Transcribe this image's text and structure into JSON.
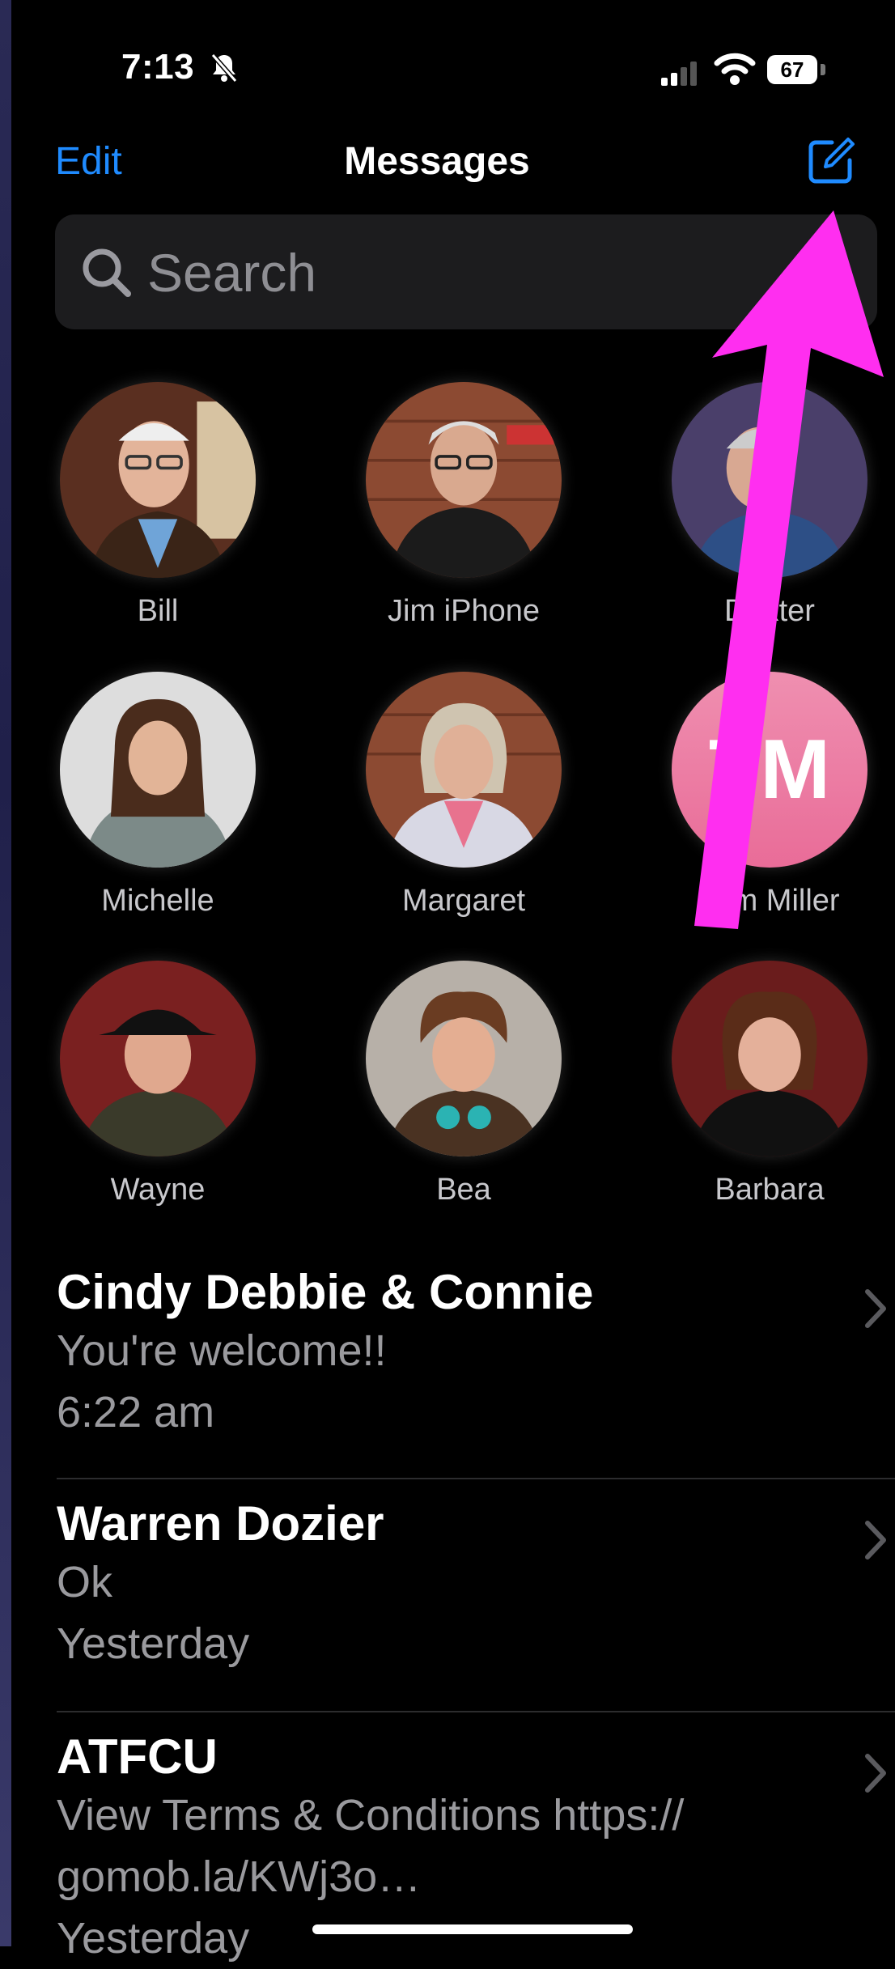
{
  "status_bar": {
    "time": "7:13",
    "battery": "67"
  },
  "nav": {
    "edit_label": "Edit",
    "title": "Messages"
  },
  "search": {
    "placeholder": "Search"
  },
  "pinned": [
    {
      "name": "Bill"
    },
    {
      "name": "Jim iPhone"
    },
    {
      "name": "Dexter"
    },
    {
      "name": "Michelle"
    },
    {
      "name": "Margaret"
    },
    {
      "name": "Tom Miller",
      "initials": "TM"
    },
    {
      "name": "Wayne"
    },
    {
      "name": "Bea"
    },
    {
      "name": "Barbara"
    }
  ],
  "conversations": [
    {
      "name": "Cindy Debbie & Connie",
      "preview": "You're welcome!!",
      "time": "6:22 am"
    },
    {
      "name": "Warren  Dozier",
      "preview": "Ok",
      "time": "Yesterday"
    },
    {
      "name": "ATFCU",
      "preview": "View Terms & Conditions https:// gomob.la/KWj3o…",
      "time": "Yesterday"
    }
  ],
  "colors": {
    "accent": "#1f8bff",
    "annotation_arrow": "#ff2ef0",
    "initials_avatar": "#ec7ba3"
  }
}
